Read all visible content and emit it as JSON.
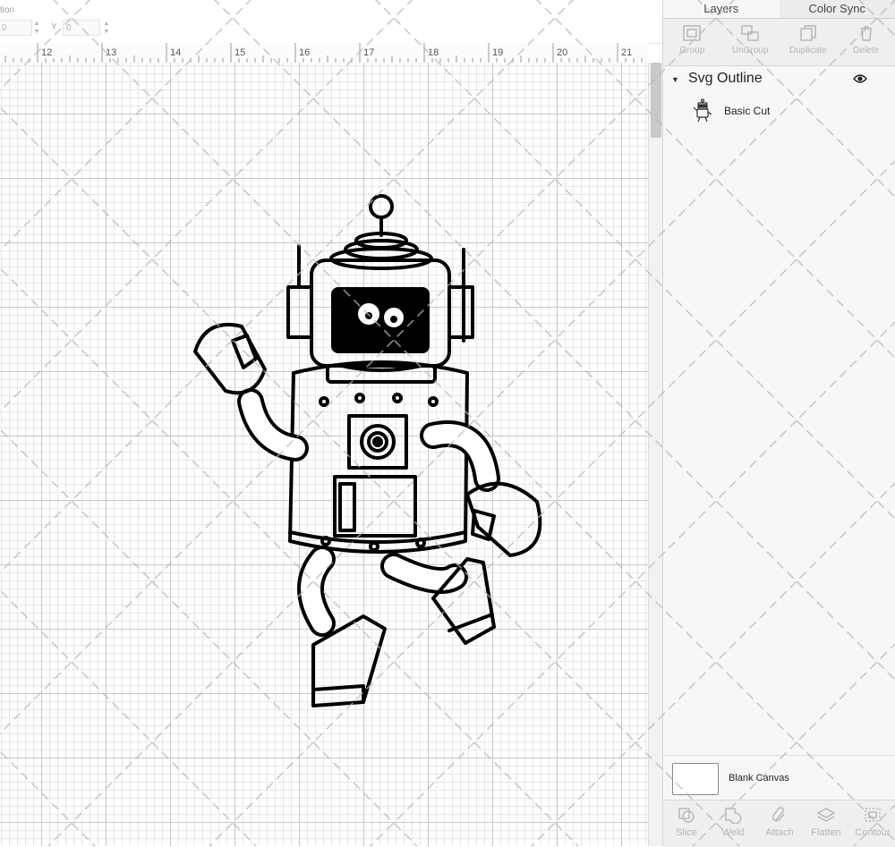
{
  "position_bar": {
    "label_partial": "tion",
    "x_value": "0",
    "y_label": "Y",
    "y_value": "0"
  },
  "ruler": {
    "marks": [
      "12",
      "13",
      "14",
      "15",
      "16",
      "17",
      "18",
      "19",
      "20",
      "21"
    ]
  },
  "layers_panel": {
    "tabs": [
      {
        "label": "Layers",
        "active": true
      },
      {
        "label": "Color Sync",
        "active": false
      }
    ],
    "toolbar": [
      {
        "label": "Group",
        "icon": "group-icon",
        "enabled": false
      },
      {
        "label": "UnGroup",
        "icon": "ungroup-icon",
        "enabled": false
      },
      {
        "label": "Duplicate",
        "icon": "duplicate-icon",
        "enabled": false
      },
      {
        "label": "Delete",
        "icon": "trash-icon",
        "enabled": false
      }
    ],
    "group": {
      "title": "Svg Outline",
      "expanded": true,
      "visible": true,
      "items": [
        {
          "label": "Basic Cut",
          "icon": "robot-thumbnail"
        }
      ]
    },
    "blank_canvas": {
      "label": "Blank Canvas"
    },
    "bottom_toolbar": [
      {
        "label": "Slice",
        "icon": "slice-icon",
        "enabled": false
      },
      {
        "label": "Weld",
        "icon": "weld-icon",
        "enabled": false
      },
      {
        "label": "Attach",
        "icon": "attach-icon",
        "enabled": false
      },
      {
        "label": "Flatten",
        "icon": "flatten-icon",
        "enabled": false
      },
      {
        "label": "Contour",
        "icon": "contour-icon",
        "enabled": false
      }
    ]
  },
  "colors": {
    "grid_major": "#c8c8c8",
    "grid_minor": "#e6e6e6",
    "panel_bg": "#f7f7f7",
    "disabled_text": "#b5b5b5",
    "outline": "#000000"
  }
}
